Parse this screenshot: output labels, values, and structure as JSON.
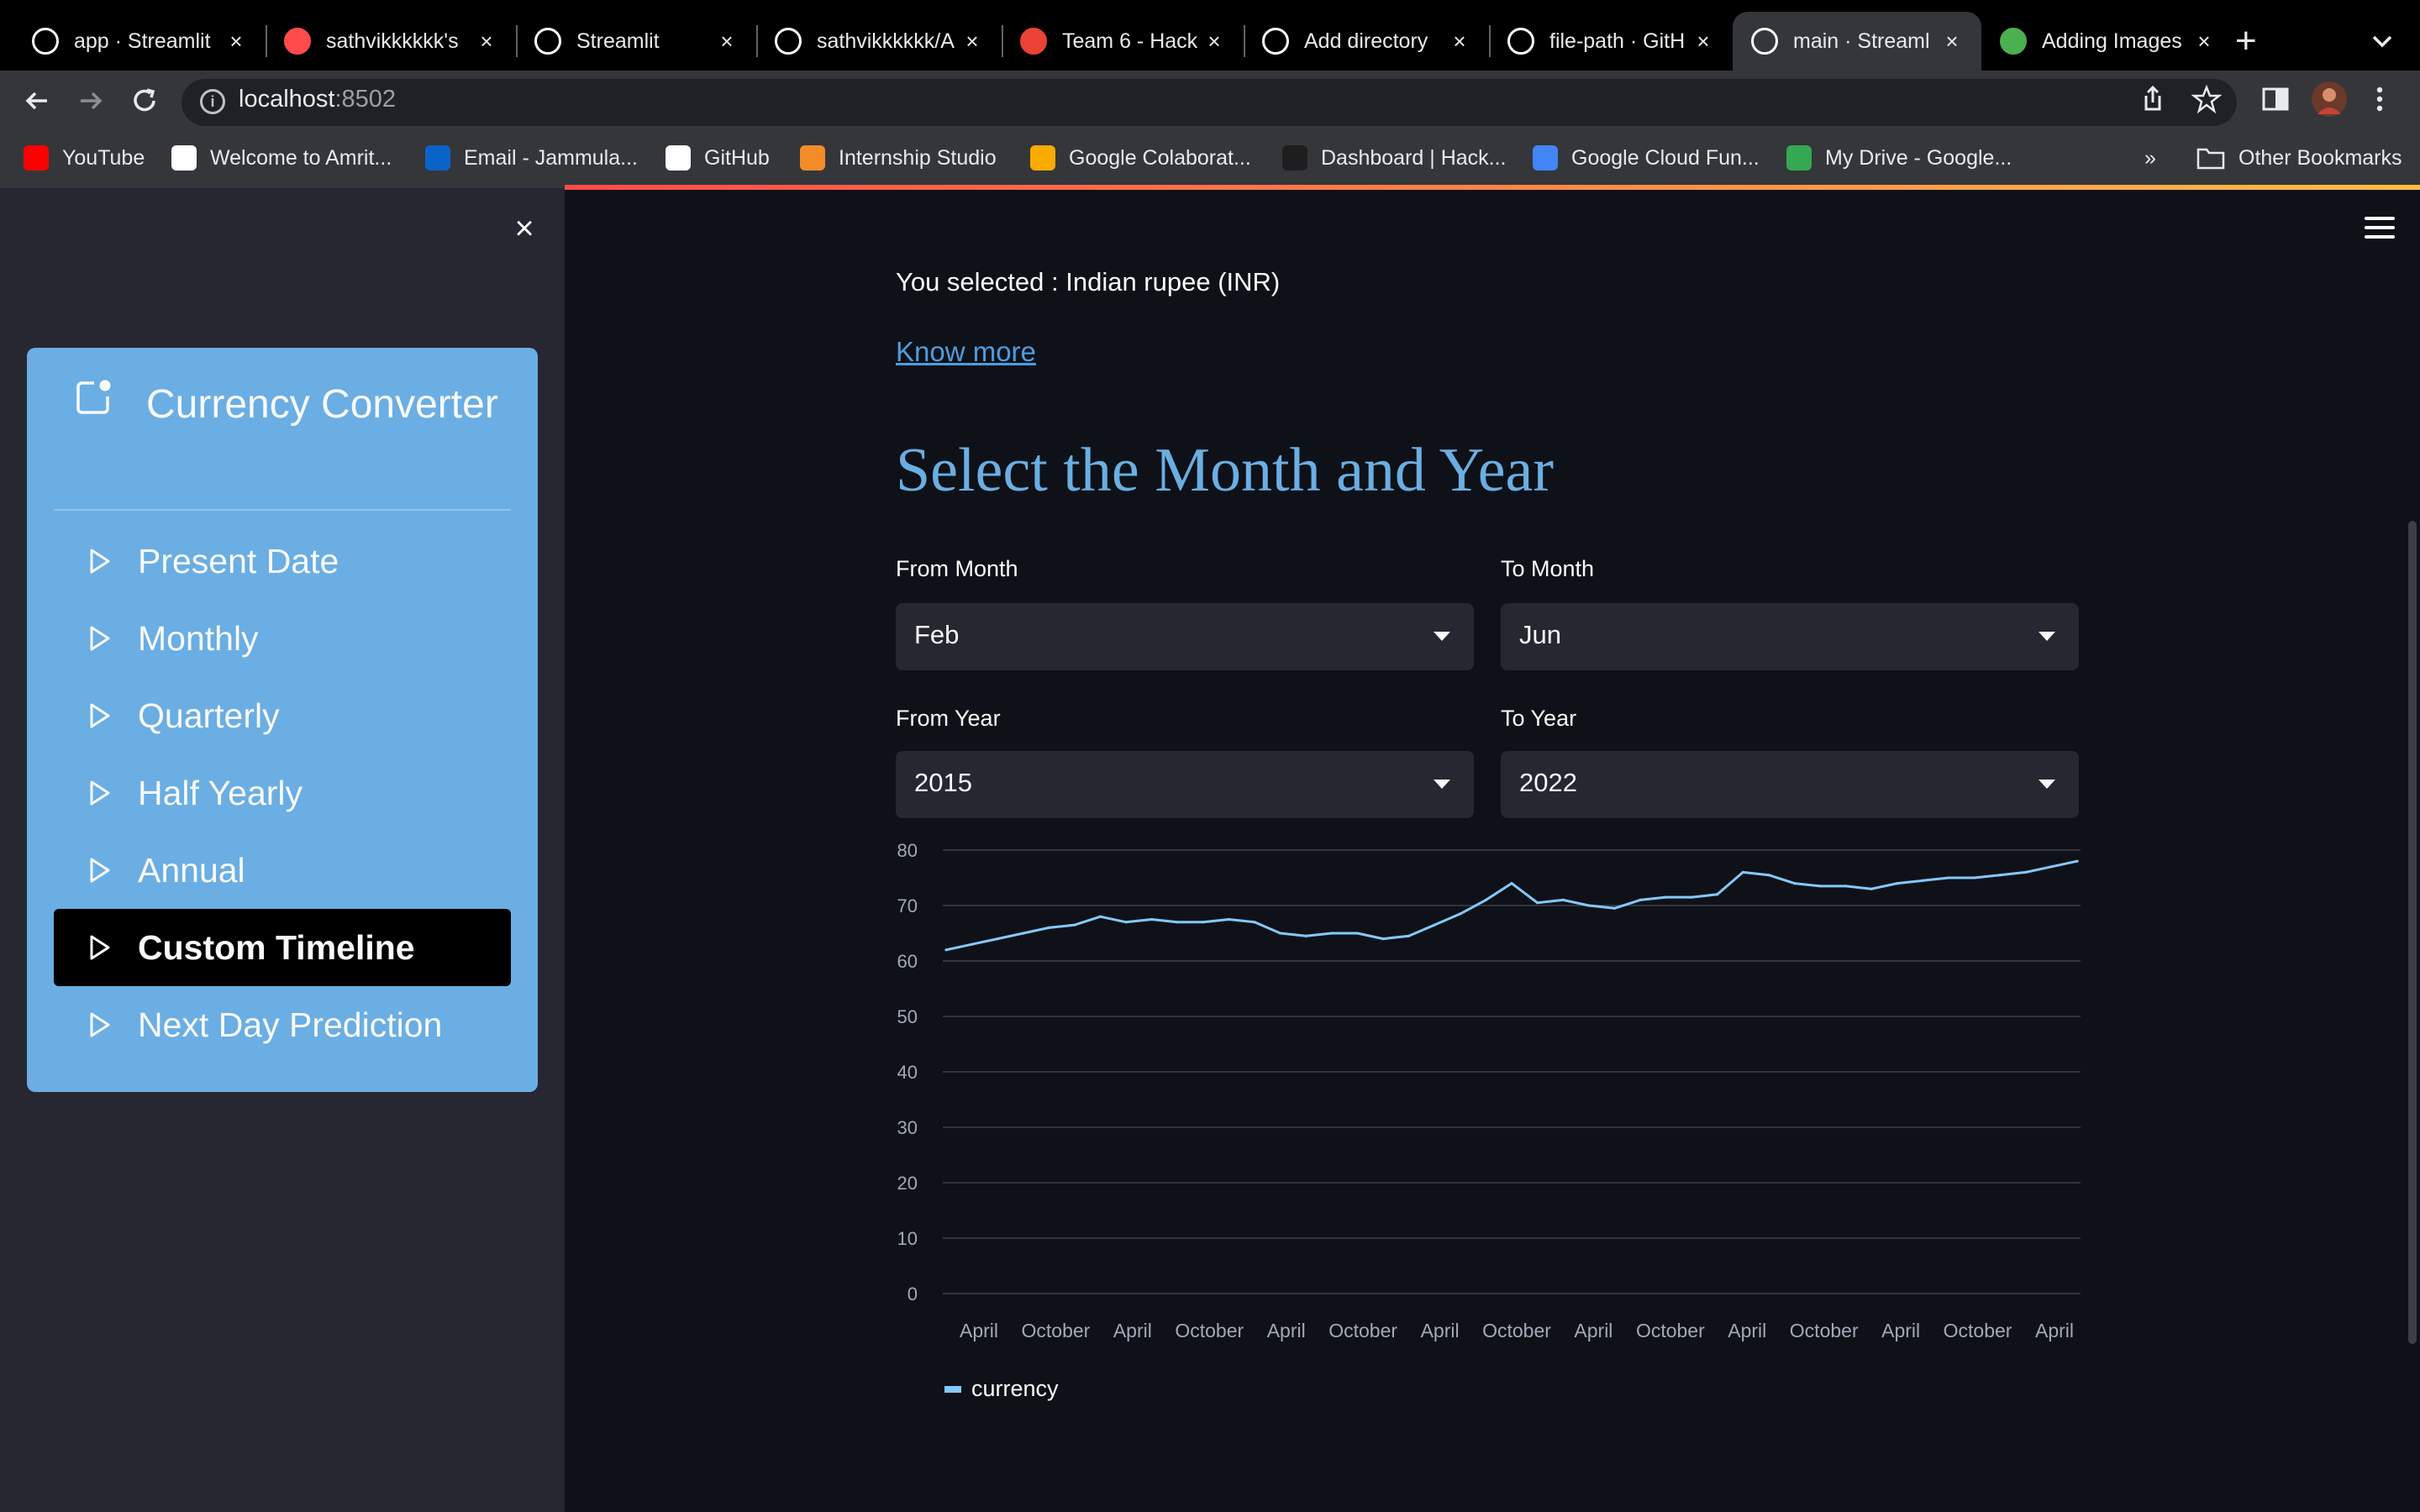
{
  "browser": {
    "tabs": [
      {
        "label": "app · Streamlit",
        "favicon": "streamlit-crown-icon",
        "color": "#ffffff"
      },
      {
        "label": "sathvikkkkkk's",
        "favicon": "streamlit-red-icon",
        "color": "#ff4b4b"
      },
      {
        "label": "Streamlit",
        "favicon": "streamlit-crown-icon",
        "color": "#ffffff"
      },
      {
        "label": "sathvikkkkkk/A",
        "favicon": "github-icon",
        "color": "#ffffff"
      },
      {
        "label": "Team 6 - Hack",
        "favicon": "gmail-icon",
        "color": "#ea4335"
      },
      {
        "label": "Add directory",
        "favicon": "github-icon",
        "color": "#ffffff"
      },
      {
        "label": "file-path · GitH",
        "favicon": "github-icon",
        "color": "#ffffff"
      },
      {
        "label": "main · Streaml",
        "favicon": "streamlit-crown-icon",
        "color": "#ffffff"
      },
      {
        "label": "Adding Images",
        "favicon": "globe-icon",
        "color": "#4caf50"
      }
    ],
    "url_host": "localhost",
    "url_port": ":8502",
    "bookmarks": [
      {
        "label": "YouTube",
        "icon": "youtube-icon",
        "color": "#ff0000"
      },
      {
        "label": "Welcome to Amrit...",
        "icon": "amrita-icon",
        "color": "#ffffff"
      },
      {
        "label": "Email - Jammula...",
        "icon": "outlook-icon",
        "color": "#0a64c8"
      },
      {
        "label": "GitHub",
        "icon": "github-icon",
        "color": "#ffffff"
      },
      {
        "label": "Internship Studio",
        "icon": "internship-studio-icon",
        "color": "#f28c28"
      },
      {
        "label": "Google Colaborat...",
        "icon": "colab-icon",
        "color": "#f9ab00"
      },
      {
        "label": "Dashboard | Hack...",
        "icon": "hackerearth-icon",
        "color": "#1e1e1e"
      },
      {
        "label": "Google Cloud Fun...",
        "icon": "cloud-functions-icon",
        "color": "#4285f4"
      },
      {
        "label": "My Drive - Google...",
        "icon": "google-drive-icon",
        "color": "#34a853"
      }
    ],
    "overflow_label": "»",
    "other_bookmarks": "Other Bookmarks"
  },
  "sidebar": {
    "close_icon": "close-icon",
    "menu_title": "Currency Converter",
    "menu_title_icon": "app-indicator-icon",
    "items": [
      {
        "label": "Present Date",
        "selected": false
      },
      {
        "label": "Monthly",
        "selected": false
      },
      {
        "label": "Quarterly",
        "selected": false
      },
      {
        "label": "Half Yearly",
        "selected": false
      },
      {
        "label": "Annual",
        "selected": false
      },
      {
        "label": "Custom Timeline",
        "selected": true
      },
      {
        "label": "Next Day Prediction",
        "selected": false
      }
    ],
    "accent_color": "#6aaee3"
  },
  "main": {
    "selected_text": "You selected : Indian rupee (INR)",
    "know_more": "Know more",
    "section_title": "Select the Month and Year",
    "from_month": {
      "label": "From Month",
      "value": "Feb"
    },
    "to_month": {
      "label": "To Month",
      "value": "Jun"
    },
    "from_year": {
      "label": "From Year",
      "value": "2015"
    },
    "to_year": {
      "label": "To Year",
      "value": "2022"
    }
  },
  "chart_data": {
    "type": "line",
    "series": [
      {
        "name": "currency",
        "color": "#83c9ff",
        "x": [
          "2015-02",
          "2015-04",
          "2015-06",
          "2015-08",
          "2015-10",
          "2015-12",
          "2016-02",
          "2016-04",
          "2016-06",
          "2016-08",
          "2016-10",
          "2016-12",
          "2017-02",
          "2017-04",
          "2017-06",
          "2017-08",
          "2017-10",
          "2017-12",
          "2018-02",
          "2018-04",
          "2018-06",
          "2018-08",
          "2018-10",
          "2018-12",
          "2019-02",
          "2019-04",
          "2019-06",
          "2019-08",
          "2019-10",
          "2019-12",
          "2020-02",
          "2020-04",
          "2020-06",
          "2020-08",
          "2020-10",
          "2020-12",
          "2021-02",
          "2021-04",
          "2021-06",
          "2021-08",
          "2021-10",
          "2021-12",
          "2022-02",
          "2022-04",
          "2022-06"
        ],
        "values": [
          62,
          63,
          64,
          65,
          66,
          66.5,
          68,
          67,
          67.5,
          67,
          67,
          67.5,
          67,
          65,
          64.5,
          65,
          65,
          64,
          64.5,
          66.5,
          68.5,
          71,
          74,
          70.5,
          71,
          70,
          69.5,
          71,
          71.5,
          71.5,
          72,
          76,
          75.5,
          74,
          73.5,
          73.5,
          73,
          74,
          74.5,
          75,
          75,
          75.5,
          76,
          77,
          78
        ]
      }
    ],
    "x_ticks": [
      "April",
      "October",
      "April",
      "October",
      "April",
      "October",
      "April",
      "October",
      "April",
      "October",
      "April",
      "October",
      "April",
      "October",
      "April"
    ],
    "y_ticks": [
      0,
      10,
      20,
      30,
      40,
      50,
      60,
      70,
      80
    ],
    "ylim": [
      0,
      80
    ],
    "grid": true,
    "legend": "bottom-left",
    "xlabel": "",
    "ylabel": ""
  }
}
